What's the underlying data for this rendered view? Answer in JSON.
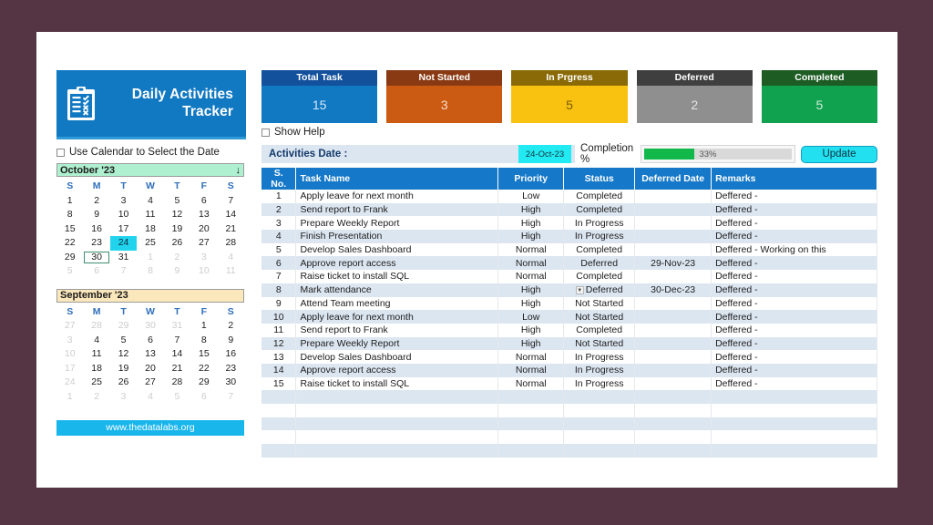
{
  "theme": {
    "page_bg": "#553443",
    "panel_bg": "#ffffff",
    "brand_blue": "#1178c2",
    "header_blue": "#1578c8",
    "row_alt": "#dce6f1",
    "accent_cyan": "#22e0f0",
    "progress_green": "#12b84a"
  },
  "logo": {
    "title_line1": "Daily Activities",
    "title_line2": "Tracker",
    "icon": "clipboard-checklist-icon"
  },
  "use_calendar": {
    "label": "Use Calendar to Select the Date",
    "checked": false
  },
  "show_help": {
    "label": "Show Help",
    "checked": false
  },
  "calendars": [
    {
      "name": "october",
      "title": "October '23",
      "header_color": "#aef0cf",
      "scroll_icon": "arrow-down-icon",
      "dow": [
        "S",
        "M",
        "T",
        "W",
        "T",
        "F",
        "S"
      ],
      "weeks": [
        [
          {
            "d": "1"
          },
          {
            "d": "2"
          },
          {
            "d": "3"
          },
          {
            "d": "4"
          },
          {
            "d": "5"
          },
          {
            "d": "6"
          },
          {
            "d": "7"
          }
        ],
        [
          {
            "d": "8"
          },
          {
            "d": "9"
          },
          {
            "d": "10"
          },
          {
            "d": "11"
          },
          {
            "d": "12"
          },
          {
            "d": "13"
          },
          {
            "d": "14"
          }
        ],
        [
          {
            "d": "15"
          },
          {
            "d": "16"
          },
          {
            "d": "17"
          },
          {
            "d": "18"
          },
          {
            "d": "19"
          },
          {
            "d": "20"
          },
          {
            "d": "21"
          }
        ],
        [
          {
            "d": "22"
          },
          {
            "d": "23"
          },
          {
            "d": "24",
            "state": "selected"
          },
          {
            "d": "25"
          },
          {
            "d": "26"
          },
          {
            "d": "27"
          },
          {
            "d": "28"
          }
        ],
        [
          {
            "d": "29"
          },
          {
            "d": "30",
            "state": "boxed"
          },
          {
            "d": "31"
          },
          {
            "d": "1",
            "state": "muted"
          },
          {
            "d": "2",
            "state": "muted"
          },
          {
            "d": "3",
            "state": "muted"
          },
          {
            "d": "4",
            "state": "muted"
          }
        ],
        [
          {
            "d": "5",
            "state": "muted"
          },
          {
            "d": "6",
            "state": "muted"
          },
          {
            "d": "7",
            "state": "muted"
          },
          {
            "d": "8",
            "state": "muted"
          },
          {
            "d": "9",
            "state": "muted"
          },
          {
            "d": "10",
            "state": "muted"
          },
          {
            "d": "11",
            "state": "muted"
          }
        ]
      ]
    },
    {
      "name": "september",
      "title": "September '23",
      "header_color": "#fbe7bc",
      "dow": [
        "S",
        "M",
        "T",
        "W",
        "T",
        "F",
        "S"
      ],
      "weeks": [
        [
          {
            "d": "27",
            "state": "muted"
          },
          {
            "d": "28",
            "state": "muted"
          },
          {
            "d": "29",
            "state": "muted"
          },
          {
            "d": "30",
            "state": "muted"
          },
          {
            "d": "31",
            "state": "muted"
          },
          {
            "d": "1"
          },
          {
            "d": "2"
          }
        ],
        [
          {
            "d": "3",
            "state": "muted"
          },
          {
            "d": "4"
          },
          {
            "d": "5"
          },
          {
            "d": "6"
          },
          {
            "d": "7"
          },
          {
            "d": "8"
          },
          {
            "d": "9"
          }
        ],
        [
          {
            "d": "10",
            "state": "muted"
          },
          {
            "d": "11"
          },
          {
            "d": "12"
          },
          {
            "d": "13"
          },
          {
            "d": "14"
          },
          {
            "d": "15"
          },
          {
            "d": "16"
          }
        ],
        [
          {
            "d": "17",
            "state": "muted"
          },
          {
            "d": "18"
          },
          {
            "d": "19"
          },
          {
            "d": "20"
          },
          {
            "d": "21"
          },
          {
            "d": "22"
          },
          {
            "d": "23"
          }
        ],
        [
          {
            "d": "24",
            "state": "muted"
          },
          {
            "d": "25"
          },
          {
            "d": "26"
          },
          {
            "d": "27"
          },
          {
            "d": "28"
          },
          {
            "d": "29"
          },
          {
            "d": "30"
          }
        ],
        [
          {
            "d": "1",
            "state": "muted"
          },
          {
            "d": "2",
            "state": "muted"
          },
          {
            "d": "3",
            "state": "muted"
          },
          {
            "d": "4",
            "state": "muted"
          },
          {
            "d": "5",
            "state": "muted"
          },
          {
            "d": "6",
            "state": "muted"
          },
          {
            "d": "7",
            "state": "muted"
          }
        ]
      ]
    }
  ],
  "site_button": {
    "label": "www.thedatalabs.org"
  },
  "kpis": [
    {
      "name": "total-task",
      "label": "Total Task",
      "value": "15",
      "head_color": "#13519c",
      "body_color": "#1178c2",
      "value_color": "#d7e8f7"
    },
    {
      "name": "not-started",
      "label": "Not Started",
      "value": "3",
      "head_color": "#8a3a12",
      "body_color": "#cb5b12",
      "value_color": "#f6ddcb"
    },
    {
      "name": "in-progress",
      "label": "In Prgress",
      "value": "5",
      "head_color": "#8a6a06",
      "body_color": "#f9c210",
      "value_color": "#7a5c05"
    },
    {
      "name": "deferred",
      "label": "Deferred",
      "value": "2",
      "head_color": "#3f3f3f",
      "body_color": "#8f8f8f",
      "value_color": "#e4e4e4"
    },
    {
      "name": "completed",
      "label": "Completed",
      "value": "5",
      "head_color": "#1d5c23",
      "body_color": "#11a24f",
      "value_color": "#cdeddb"
    }
  ],
  "activities_bar": {
    "label": "Activities Date :",
    "date_value": "24-Oct-23",
    "completion_label": "Completion %",
    "progress_percent": 33,
    "progress_text": "33%",
    "update_label": "Update"
  },
  "table": {
    "columns": [
      "S. No.",
      "Task Name",
      "Priority",
      "Status",
      "Deferred Date",
      "Remarks"
    ],
    "rows": [
      {
        "sno": "1",
        "task": "Apply leave for next month",
        "priority": "Low",
        "status": "Completed",
        "deferred_date": "",
        "remarks": "Deffered -"
      },
      {
        "sno": "2",
        "task": "Send report to Frank",
        "priority": "High",
        "status": "Completed",
        "deferred_date": "",
        "remarks": "Deffered -"
      },
      {
        "sno": "3",
        "task": "Prepare Weekly Report",
        "priority": "High",
        "status": "In Progress",
        "deferred_date": "",
        "remarks": "Deffered -"
      },
      {
        "sno": "4",
        "task": "Finish Presentation",
        "priority": "High",
        "status": "In Progress",
        "deferred_date": "",
        "remarks": "Deffered -"
      },
      {
        "sno": "5",
        "task": "Develop Sales Dashboard",
        "priority": "Normal",
        "status": "Completed",
        "deferred_date": "",
        "remarks": "Deffered - Working on this"
      },
      {
        "sno": "6",
        "task": "Approve report access",
        "priority": "Normal",
        "status": "Deferred",
        "deferred_date": "29-Nov-23",
        "remarks": "Deffered -"
      },
      {
        "sno": "7",
        "task": "Raise ticket to install SQL",
        "priority": "Normal",
        "status": "Completed",
        "deferred_date": "",
        "remarks": "Deffered -"
      },
      {
        "sno": "8",
        "task": "Mark attendance",
        "priority": "High",
        "status": "Deferred",
        "deferred_date": "30-Dec-23",
        "remarks": "Deffered -",
        "status_dropdown": true
      },
      {
        "sno": "9",
        "task": "Attend Team meeting",
        "priority": "High",
        "status": "Not Started",
        "deferred_date": "",
        "remarks": "Deffered -"
      },
      {
        "sno": "10",
        "task": "Apply leave for next month",
        "priority": "Low",
        "status": "Not Started",
        "deferred_date": "",
        "remarks": "Deffered -"
      },
      {
        "sno": "11",
        "task": "Send report to Frank",
        "priority": "High",
        "status": "Completed",
        "deferred_date": "",
        "remarks": "Deffered -"
      },
      {
        "sno": "12",
        "task": "Prepare Weekly Report",
        "priority": "High",
        "status": "Not Started",
        "deferred_date": "",
        "remarks": "Deffered -"
      },
      {
        "sno": "13",
        "task": "Develop Sales Dashboard",
        "priority": "Normal",
        "status": "In Progress",
        "deferred_date": "",
        "remarks": "Deffered -"
      },
      {
        "sno": "14",
        "task": "Approve report access",
        "priority": "Normal",
        "status": "In Progress",
        "deferred_date": "",
        "remarks": "Deffered -"
      },
      {
        "sno": "15",
        "task": "Raise ticket to install SQL",
        "priority": "Normal",
        "status": "In Progress",
        "deferred_date": "",
        "remarks": "Deffered -"
      },
      {
        "sno": "",
        "task": "",
        "priority": "",
        "status": "",
        "deferred_date": "",
        "remarks": ""
      },
      {
        "sno": "",
        "task": "",
        "priority": "",
        "status": "",
        "deferred_date": "",
        "remarks": ""
      },
      {
        "sno": "",
        "task": "",
        "priority": "",
        "status": "",
        "deferred_date": "",
        "remarks": ""
      },
      {
        "sno": "",
        "task": "",
        "priority": "",
        "status": "",
        "deferred_date": "",
        "remarks": ""
      },
      {
        "sno": "",
        "task": "",
        "priority": "",
        "status": "",
        "deferred_date": "",
        "remarks": ""
      }
    ]
  }
}
